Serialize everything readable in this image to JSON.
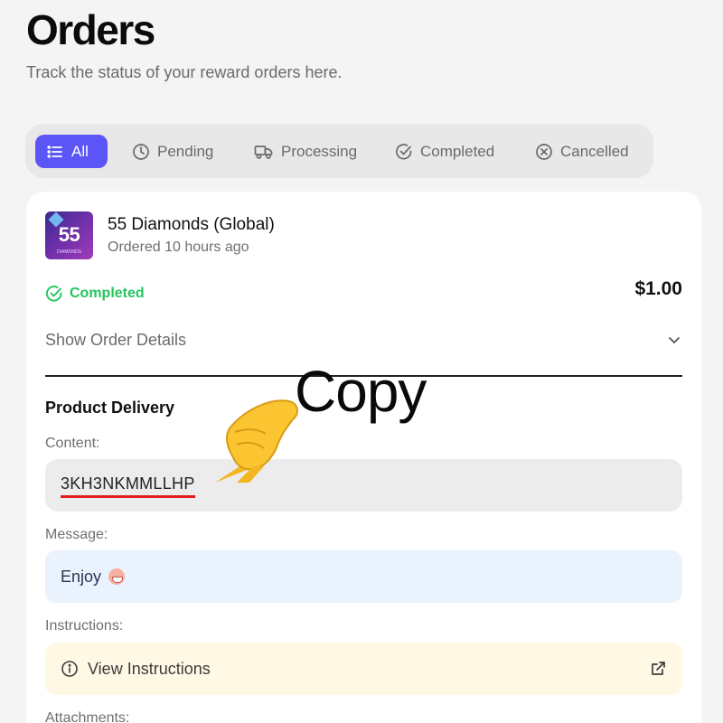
{
  "page": {
    "title": "Orders",
    "subtitle": "Track the status of your reward orders here."
  },
  "filters": {
    "tabs": [
      {
        "label": "All",
        "icon": "list-icon",
        "active": true
      },
      {
        "label": "Pending",
        "icon": "clock-icon",
        "active": false
      },
      {
        "label": "Processing",
        "icon": "truck-icon",
        "active": false
      },
      {
        "label": "Completed",
        "icon": "check-circle-icon",
        "active": false
      },
      {
        "label": "Cancelled",
        "icon": "x-circle-icon",
        "active": false
      }
    ]
  },
  "order": {
    "thumbnail": {
      "text": "55",
      "subtext": "DIAMONDS"
    },
    "product_name": "55 Diamonds (Global)",
    "ordered_time": "Ordered 10 hours ago",
    "status": "Completed",
    "price": "$1.00",
    "details_toggle": "Show Order Details",
    "delivery": {
      "section_title": "Product Delivery",
      "content_label": "Content:",
      "content_value": "3KH3NKMMLLHP",
      "message_label": "Message:",
      "message_value": "Enjoy",
      "instructions_label": "Instructions:",
      "instructions_link": "View Instructions",
      "attachments_label": "Attachments:"
    }
  },
  "overlay": {
    "annotation": "Copy",
    "hand_icon": "pointing-hand-icon"
  },
  "colors": {
    "accent": "#5b55f5",
    "success": "#22c55e",
    "underline": "#e11d1d",
    "message_bg": "#eaf2fe",
    "instructions_bg": "#fef8e4"
  }
}
